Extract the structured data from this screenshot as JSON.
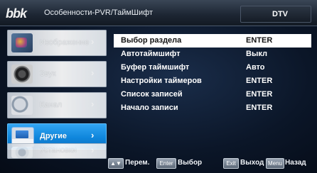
{
  "header": {
    "logo": "bbk",
    "title": "Особенности-PVR/ТаймШифт",
    "source": "DTV"
  },
  "categories": [
    {
      "label": "Изображение",
      "icon": "picture-icon",
      "chevron": "›"
    },
    {
      "label": "Звук",
      "icon": "speaker-icon",
      "chevron": "›"
    },
    {
      "label": "Канал",
      "icon": "satellite-dish-icon",
      "chevron": "›"
    },
    {
      "label": "Другие",
      "icon": "monitor-icon",
      "chevron": "›",
      "active": true
    },
    {
      "label": "Установки",
      "icon": "settings-disc-icon",
      "chevron": "›"
    }
  ],
  "options": [
    {
      "name": "Выбор раздела",
      "value": "ENTER",
      "selected": true
    },
    {
      "name": "Автотаймшифт",
      "value": "Выкл"
    },
    {
      "name": "Буфер таймшифт",
      "value": "Авто"
    },
    {
      "name": "Настройки таймеров",
      "value": "ENTER"
    },
    {
      "name": "Список записей",
      "value": "ENTER"
    },
    {
      "name": "Начало записи",
      "value": "ENTER"
    }
  ],
  "footer": {
    "move_label": "Перем.",
    "enter_key": "Enter",
    "select_label": "Выбор",
    "exit_key": "Exit",
    "exit_label": "Выход",
    "menu_key": "Menu",
    "back_label": "Назад"
  },
  "colors": {
    "accent": "#1a8fe0",
    "selected_row": "#ffffff",
    "background": "#0b1628"
  }
}
